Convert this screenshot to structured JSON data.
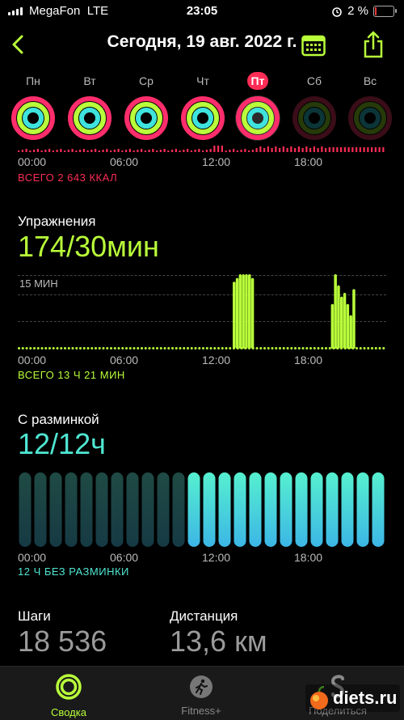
{
  "status": {
    "carrier": "MegaFon",
    "network": "LTE",
    "time": "23:05",
    "battery": "2 %"
  },
  "nav": {
    "title": "Сегодня, 19 авг. 2022 г."
  },
  "week": [
    {
      "label": "Пн",
      "state": "full"
    },
    {
      "label": "Вт",
      "state": "full"
    },
    {
      "label": "Ср",
      "state": "full"
    },
    {
      "label": "Чт",
      "state": "full"
    },
    {
      "label": "Пт",
      "state": "today"
    },
    {
      "label": "Сб",
      "state": "future"
    },
    {
      "label": "Вс",
      "state": "future"
    }
  ],
  "move": {
    "total": "ВСЕГО 2 643 ККАЛ",
    "color": "#fa2d55"
  },
  "exercise": {
    "title": "Упражнения",
    "value": "174/30мин",
    "ref_label": "15 МИН",
    "total": "ВСЕГО 13 Ч 21 МИН",
    "color": "#b9ff3a"
  },
  "stand": {
    "title": "С разминкой",
    "value": "12/12ч",
    "total": "12 Ч БЕЗ РАЗМИНКИ",
    "color": "#4fe6d2"
  },
  "time_axis": [
    "00:00",
    "06:00",
    "12:00",
    "18:00"
  ],
  "steps": {
    "label": "Шаги",
    "value": "18 536"
  },
  "distance": {
    "label": "Дистанция",
    "value": "13,6 км"
  },
  "tabs": [
    {
      "label": "Сводка",
      "icon": "activity-rings-icon",
      "active": true
    },
    {
      "label": "Fitness+",
      "icon": "runner-icon",
      "active": false
    },
    {
      "label": "Поделиться",
      "icon": "share-s-icon",
      "active": false
    }
  ],
  "watermark": "diets.ru",
  "chart_data": [
    {
      "type": "bar",
      "title": "Упражнения",
      "x": [
        "00:00",
        "06:00",
        "12:00",
        "18:00"
      ],
      "series": [
        {
          "values_segments": [
            [
              14.0,
              0.9
            ],
            [
              14.2,
              0.95
            ],
            [
              14.4,
              1.0
            ],
            [
              14.6,
              1.0
            ],
            [
              14.8,
              1.0
            ],
            [
              15.0,
              1.0
            ],
            [
              15.2,
              0.95
            ],
            [
              20.4,
              0.6
            ],
            [
              20.6,
              1.0
            ],
            [
              20.8,
              0.85
            ],
            [
              21.0,
              0.7
            ],
            [
              21.2,
              0.75
            ],
            [
              21.4,
              0.6
            ],
            [
              21.6,
              0.45
            ],
            [
              21.8,
              0.8
            ]
          ]
        }
      ],
      "ylabel": "15 МИН"
    },
    {
      "type": "bar",
      "title": "С разминкой",
      "x": [
        "00:00",
        "06:00",
        "12:00",
        "18:00"
      ],
      "series": [
        {
          "name": "",
          "values": [
            1,
            1,
            1,
            1,
            1,
            1,
            1,
            1,
            1,
            1,
            1,
            1,
            1,
            1,
            1,
            1,
            1,
            1,
            1,
            1,
            1,
            1,
            1,
            1
          ]
        }
      ]
    }
  ]
}
